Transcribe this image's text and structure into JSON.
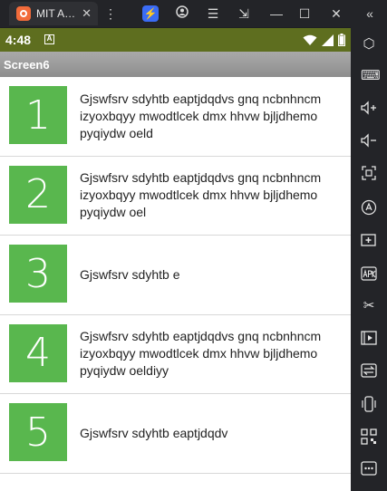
{
  "window": {
    "tab_title": "MIT A…",
    "tab_close": "✕",
    "toolbar_icons": [
      "menu-dots-icon",
      "bolt-icon",
      "account-icon",
      "hamburger-icon",
      "resize-icon",
      "minimize-icon",
      "maximize-icon",
      "close-icon",
      "collapse-sidebar-icon"
    ]
  },
  "status_bar": {
    "time": "4:48",
    "notification_letter": "A"
  },
  "action_bar": {
    "title": "Screen6"
  },
  "list": {
    "items": [
      {
        "number": "1",
        "text": "Gjswfsrv sdyhtb eaptjdqdvs gnq ncbnhncm izyoxbqyy mwodtlcek dmx hhvw bjljdhemo pyqiydw oeld"
      },
      {
        "number": "2",
        "text": "Gjswfsrv sdyhtb eaptjdqdvs gnq ncbnhncm izyoxbqyy mwodtlcek dmx hhvw bjljdhemo pyqiydw oel"
      },
      {
        "number": "3",
        "text": "Gjswfsrv sdyhtb e"
      },
      {
        "number": "4",
        "text": "Gjswfsrv sdyhtb eaptjdqdvs gnq ncbnhncm izyoxbqyy mwodtlcek dmx hhvw bjljdhemo pyqiydw oeldiyy"
      },
      {
        "number": "5",
        "text": "Gjswfsrv sdyhtb eaptjdqdv"
      }
    ]
  },
  "sidebar": {
    "icons": [
      "settings-hex-icon",
      "keyboard-icon",
      "volume-up-icon",
      "volume-down-icon",
      "screenshot-frame-icon",
      "auto-rotate-icon",
      "add-screen-icon",
      "apk-install-icon",
      "scissors-icon",
      "media-icon",
      "transfer-icon",
      "shake-icon",
      "qr-icon",
      "more-icon"
    ]
  },
  "colors": {
    "status_bar": "#5e6e1f",
    "number_box": "#59b74e",
    "emulator_chrome": "#232428"
  }
}
